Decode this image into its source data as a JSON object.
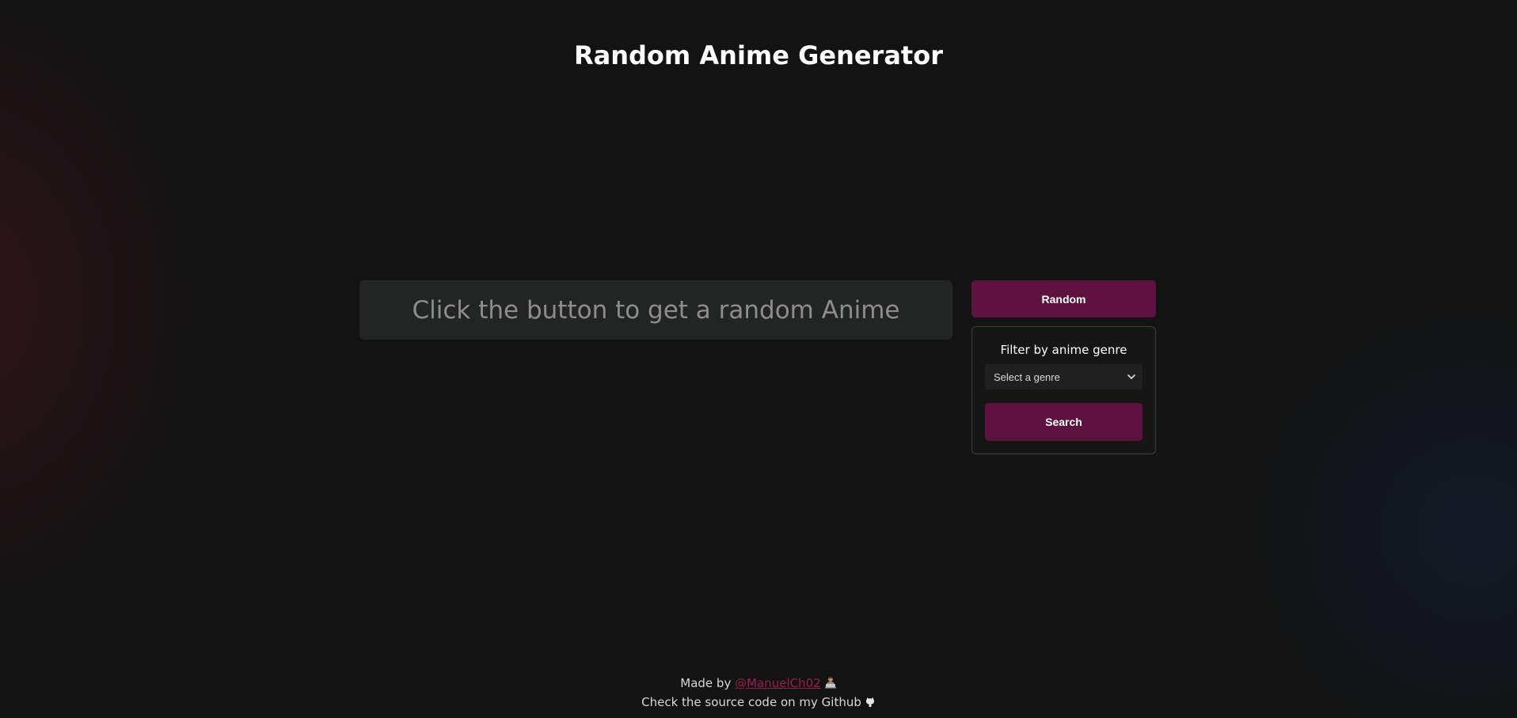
{
  "header": {
    "title": "Random Anime Generator"
  },
  "result": {
    "placeholder_text": "Click the button to get a random Anime"
  },
  "actions": {
    "random_label": "Random"
  },
  "filter": {
    "title": "Filter by anime genre",
    "select_value": "Select a genre",
    "search_label": "Search"
  },
  "footer": {
    "made_by_prefix": "Made by ",
    "author_link": "@ManuelCh02",
    "source_text": "Check the source code on my Github"
  },
  "colors": {
    "background": "#131313",
    "accent": "#5e1240",
    "link": "#9b1d52",
    "result_box": "#232424"
  },
  "icons": {
    "developer": "person-at-laptop-icon",
    "github": "github-octocat-icon",
    "select": "chevron-down-icon"
  }
}
